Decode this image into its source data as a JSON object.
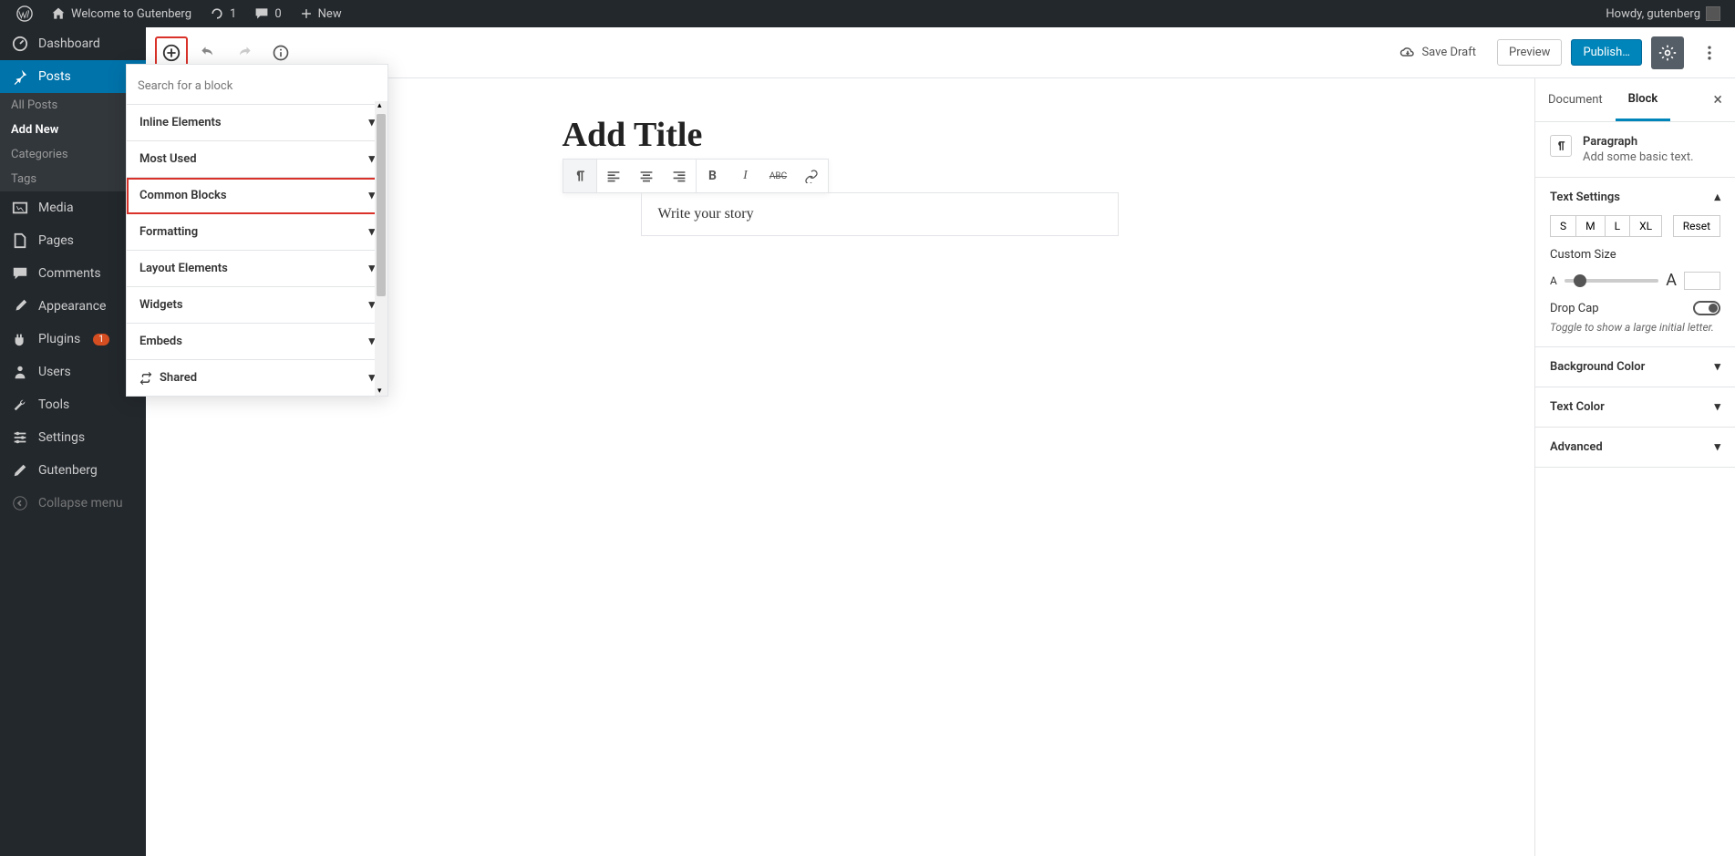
{
  "adminBar": {
    "siteTitle": "Welcome to Gutenberg",
    "updatesCount": "1",
    "commentsCount": "0",
    "newLabel": "New",
    "greeting": "Howdy, gutenberg"
  },
  "sidebar": {
    "dashboard": "Dashboard",
    "posts": "Posts",
    "postsSub": [
      "All Posts",
      "Add New",
      "Categories",
      "Tags"
    ],
    "media": "Media",
    "pages": "Pages",
    "comments": "Comments",
    "appearance": "Appearance",
    "plugins": "Plugins",
    "pluginsBadge": "1",
    "users": "Users",
    "tools": "Tools",
    "settings": "Settings",
    "gutenberg": "Gutenberg",
    "collapse": "Collapse menu"
  },
  "editorHeader": {
    "saveDraft": "Save Draft",
    "preview": "Preview",
    "publish": "Publish…"
  },
  "inserter": {
    "searchPlaceholder": "Search for a block",
    "groups": [
      "Inline Elements",
      "Most Used",
      "Common Blocks",
      "Formatting",
      "Layout Elements",
      "Widgets",
      "Embeds",
      "Shared"
    ]
  },
  "canvas": {
    "title": "Add Title",
    "paragraph": "Write your story"
  },
  "settings": {
    "tabs": {
      "document": "Document",
      "block": "Block"
    },
    "blockHeader": {
      "name": "Paragraph",
      "desc": "Add some basic text."
    },
    "textSettings": {
      "label": "Text Settings",
      "sizes": [
        "S",
        "M",
        "L",
        "XL"
      ],
      "reset": "Reset",
      "customSize": "Custom Size",
      "dropCap": "Drop Cap",
      "dropCapHelp": "Toggle to show a large initial letter."
    },
    "bgColor": "Background Color",
    "textColor": "Text Color",
    "advanced": "Advanced"
  }
}
